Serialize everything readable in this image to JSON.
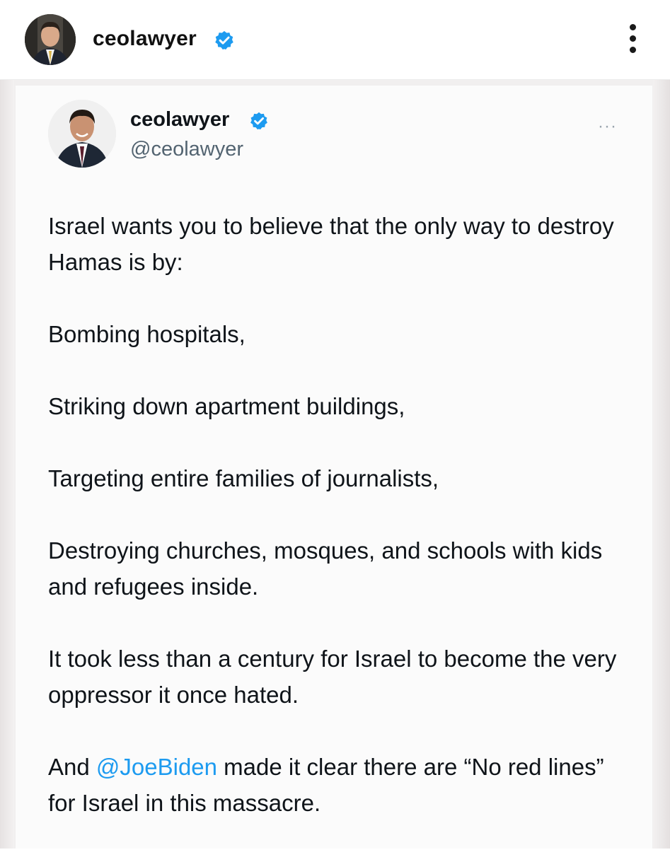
{
  "post_header": {
    "username": "ceolawyer",
    "verified_icon": "verified-badge-icon",
    "more_icon": "vertical-ellipsis-icon"
  },
  "tweet": {
    "display_name": "ceolawyer",
    "handle": "@ceolawyer",
    "more_label": "···",
    "paragraphs": {
      "p1": "Israel wants you to believe that the only way to destroy Hamas is by:",
      "p2": "Bombing hospitals,",
      "p3": "Striking down apartment buildings,",
      "p4": "Targeting entire families of journalists,",
      "p5": "Destroying churches, mosques, and schools with kids and refugees inside.",
      "p6": "It took less than a century for Israel to become the very oppressor it once hated.",
      "p7_before": "And ",
      "p7_mention": "@JoeBiden",
      "p7_after": " made it clear there are “No red lines” for Israel in this massacre."
    }
  },
  "colors": {
    "verified": "#1d9bf0",
    "mention": "#1d9bf0",
    "handle": "#536471"
  }
}
